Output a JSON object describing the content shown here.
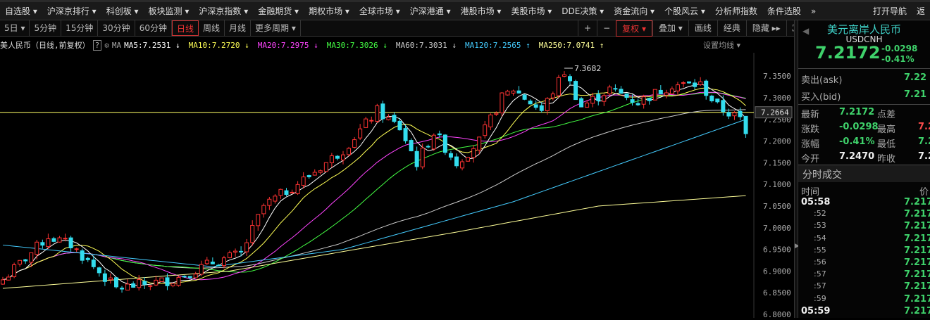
{
  "menu": {
    "items": [
      "自选股 ▾",
      "沪深京排行 ▾",
      "科创板 ▾",
      "板块监测 ▾",
      "沪深京指数 ▾",
      "金融期货 ▾",
      "期权市场 ▾",
      "全球市场 ▾",
      "沪深港通 ▾",
      "港股市场 ▾",
      "美股市场 ▾",
      "DDE决策 ▾",
      "资金流向 ▾",
      "个股风云 ▾",
      "分析师指数",
      "条件选股",
      "»"
    ],
    "open_nav": "打开导航",
    "back": "返"
  },
  "periods": [
    "5日 ▾",
    "5分钟",
    "15分钟",
    "30分钟",
    "60分钟",
    "日线",
    "周线",
    "月线",
    "更多周期 ▾"
  ],
  "active_period": "日线",
  "tools": [
    "+",
    "−",
    "复权 ▾",
    "叠加 ▾",
    "画线",
    "经典",
    "隐藏 ▸▸",
    "⛶"
  ],
  "legend": {
    "title": "美人民币（日线,前复权）",
    "help": "?",
    "ma": "MA",
    "items": [
      {
        "t": "MA5:7.2531 ↓",
        "c": "#ffffff"
      },
      {
        "t": "MA10:7.2720 ↓",
        "c": "#ffff55"
      },
      {
        "t": "MA20:7.2975 ↓",
        "c": "#ff44ff"
      },
      {
        "t": "MA30:7.3026 ↓",
        "c": "#44ff44"
      },
      {
        "t": "MA60:7.3031 ↓",
        "c": "#cccccc"
      },
      {
        "t": "MA120:7.2565 ↑",
        "c": "#44ccff"
      },
      {
        "t": "MA250:7.0741 ↑",
        "c": "#ffff99"
      }
    ],
    "settings": "设置均线 ▾"
  },
  "chart": {
    "yticks": [
      "7.3500",
      "7.3000",
      "7.2500",
      "7.2000",
      "7.1500",
      "7.1000",
      "7.0500",
      "7.0000",
      "6.9500",
      "6.9000",
      "6.8500",
      "6.8000"
    ],
    "ymin": 6.8,
    "ymax": 7.35,
    "hline": 7.2664,
    "hline_label": "7.2664",
    "max_label": "7.3682",
    "max": 7.3682,
    "close_keypoints": [
      [
        0,
        6.88
      ],
      [
        8,
        6.98
      ],
      [
        12,
        6.96
      ],
      [
        20,
        6.86
      ],
      [
        30,
        6.88
      ],
      [
        37,
        6.92
      ],
      [
        42,
        6.94
      ],
      [
        46,
        7.05
      ],
      [
        54,
        7.12
      ],
      [
        60,
        7.18
      ],
      [
        66,
        7.27
      ],
      [
        70,
        7.23
      ],
      [
        73,
        7.15
      ],
      [
        76,
        7.22
      ],
      [
        80,
        7.15
      ],
      [
        84,
        7.2
      ],
      [
        88,
        7.3
      ],
      [
        90,
        7.32
      ],
      [
        95,
        7.27
      ],
      [
        99,
        7.36
      ],
      [
        102,
        7.28
      ],
      [
        107,
        7.32
      ],
      [
        112,
        7.29
      ],
      [
        118,
        7.33
      ],
      [
        123,
        7.33
      ],
      [
        126,
        7.28
      ],
      [
        130,
        7.25
      ],
      [
        131,
        7.217
      ]
    ],
    "ma120_keypoints": [
      [
        0,
        6.96
      ],
      [
        37,
        6.91
      ],
      [
        60,
        6.95
      ],
      [
        90,
        7.06
      ],
      [
        131,
        7.25
      ]
    ],
    "ma250_keypoints": [
      [
        0,
        6.86
      ],
      [
        40,
        6.9
      ],
      [
        80,
        6.99
      ],
      [
        105,
        7.05
      ],
      [
        131,
        7.074
      ]
    ]
  },
  "quote": {
    "name": "美元离岸人民币",
    "code": "USDCNH",
    "price": "7.2172",
    "change": "-0.0298",
    "pct": "-0.41%",
    "ask_label": "卖出(ask)",
    "ask": "7.22",
    "bid_label": "买入(bid)",
    "bid": "7.21",
    "stats": [
      [
        "最新",
        "7.2172",
        "点差",
        ""
      ],
      [
        "涨跌",
        "-0.0298",
        "最高",
        "7.2"
      ],
      [
        "涨幅",
        "-0.41%",
        "最低",
        "7.2"
      ],
      [
        "今开",
        "7.2470",
        "昨收",
        "7.2"
      ]
    ]
  },
  "ticks": {
    "title": "分时成交",
    "col_time": "时间",
    "col_price": "价",
    "rows": [
      [
        "05:58",
        "7.217"
      ],
      [
        ":52",
        "7.217"
      ],
      [
        ":53",
        "7.217"
      ],
      [
        ":54",
        "7.217"
      ],
      [
        ":55",
        "7.217"
      ],
      [
        ":56",
        "7.217"
      ],
      [
        ":57",
        "7.217"
      ],
      [
        ":57",
        "7.217"
      ],
      [
        ":59",
        "7.217"
      ],
      [
        "05:59",
        "7.217"
      ]
    ]
  },
  "colors": {
    "up": "#ff3333",
    "down": "#33ddee",
    "hline": "#ffff66"
  }
}
